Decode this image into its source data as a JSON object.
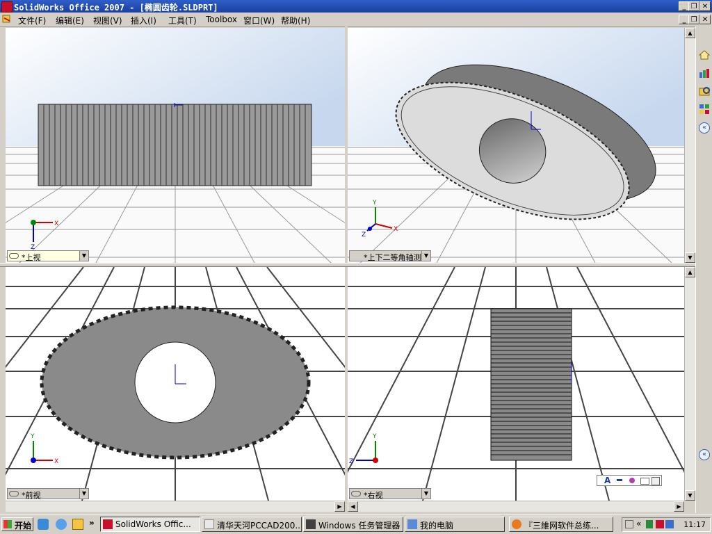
{
  "window": {
    "title": "SolidWorks Office 2007 - [椭圆齿轮.SLDPRT]",
    "minimize": "_",
    "restore": "❐",
    "close": "✕"
  },
  "menu": {
    "items": [
      "文件(F)",
      "编辑(E)",
      "视图(V)",
      "插入(I)",
      "工具(T)",
      "Toolbox",
      "窗口(W)",
      "帮助(H)"
    ]
  },
  "viewports": {
    "top": {
      "label": "*上视"
    },
    "trimetric": {
      "label": "*上下二等角轴测"
    },
    "front": {
      "label": "*前视"
    },
    "right": {
      "label": "*右视"
    }
  },
  "axes": {
    "x": "X",
    "y": "Y",
    "z": "Z"
  },
  "taskbar": {
    "start": "开始",
    "chevron": "»",
    "buttons": [
      {
        "label": "SolidWorks Offic...",
        "active": true
      },
      {
        "label": "清华天河PCCAD200..."
      },
      {
        "label": "Windows 任务管理器"
      },
      {
        "label": "我的电脑"
      },
      {
        "label": "『三維网软件总练..."
      }
    ],
    "tray_chevron": "«",
    "clock": "11:17"
  },
  "format_bar": {
    "text": "A"
  },
  "colors": {
    "titlebar": "#1a3fa0",
    "gear": "#8a8a8a",
    "sky": "#c6d7ee",
    "x_axis": "#cc0000",
    "y_axis": "#008800",
    "z_axis": "#0000cc"
  }
}
